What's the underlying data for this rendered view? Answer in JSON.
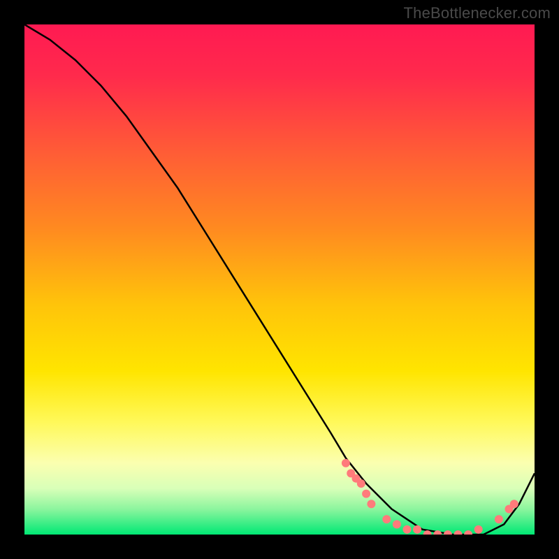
{
  "watermark": "TheBottlenecker.com",
  "chart_data": {
    "type": "line",
    "title": "",
    "xlabel": "",
    "ylabel": "",
    "xlim": [
      0,
      100
    ],
    "ylim": [
      0,
      100
    ],
    "gradient_stops": [
      {
        "offset": 0.0,
        "color": "#ff1a52"
      },
      {
        "offset": 0.1,
        "color": "#ff2a4c"
      },
      {
        "offset": 0.25,
        "color": "#ff5c36"
      },
      {
        "offset": 0.4,
        "color": "#ff8a20"
      },
      {
        "offset": 0.55,
        "color": "#ffc40a"
      },
      {
        "offset": 0.68,
        "color": "#ffe500"
      },
      {
        "offset": 0.78,
        "color": "#fff95a"
      },
      {
        "offset": 0.86,
        "color": "#fbffb0"
      },
      {
        "offset": 0.91,
        "color": "#d8ffb8"
      },
      {
        "offset": 0.95,
        "color": "#8cf59e"
      },
      {
        "offset": 1.0,
        "color": "#00e874"
      }
    ],
    "series": [
      {
        "name": "curve",
        "color": "#000000",
        "x": [
          0,
          5,
          10,
          15,
          20,
          25,
          30,
          35,
          40,
          45,
          50,
          55,
          60,
          63,
          67,
          72,
          78,
          84,
          90,
          94,
          97,
          100
        ],
        "y": [
          100,
          97,
          93,
          88,
          82,
          75,
          68,
          60,
          52,
          44,
          36,
          28,
          20,
          15,
          10,
          5,
          1,
          0,
          0,
          2,
          6,
          12
        ]
      }
    ],
    "markers": {
      "name": "dots",
      "color": "#ff7b7b",
      "radius": 6,
      "points": [
        {
          "x": 63,
          "y": 14
        },
        {
          "x": 64,
          "y": 12
        },
        {
          "x": 65,
          "y": 11
        },
        {
          "x": 66,
          "y": 10
        },
        {
          "x": 67,
          "y": 8
        },
        {
          "x": 68,
          "y": 6
        },
        {
          "x": 71,
          "y": 3
        },
        {
          "x": 73,
          "y": 2
        },
        {
          "x": 75,
          "y": 1
        },
        {
          "x": 77,
          "y": 1
        },
        {
          "x": 79,
          "y": 0
        },
        {
          "x": 81,
          "y": 0
        },
        {
          "x": 83,
          "y": 0
        },
        {
          "x": 85,
          "y": 0
        },
        {
          "x": 87,
          "y": 0
        },
        {
          "x": 89,
          "y": 1
        },
        {
          "x": 93,
          "y": 3
        },
        {
          "x": 95,
          "y": 5
        },
        {
          "x": 96,
          "y": 6
        }
      ]
    }
  }
}
